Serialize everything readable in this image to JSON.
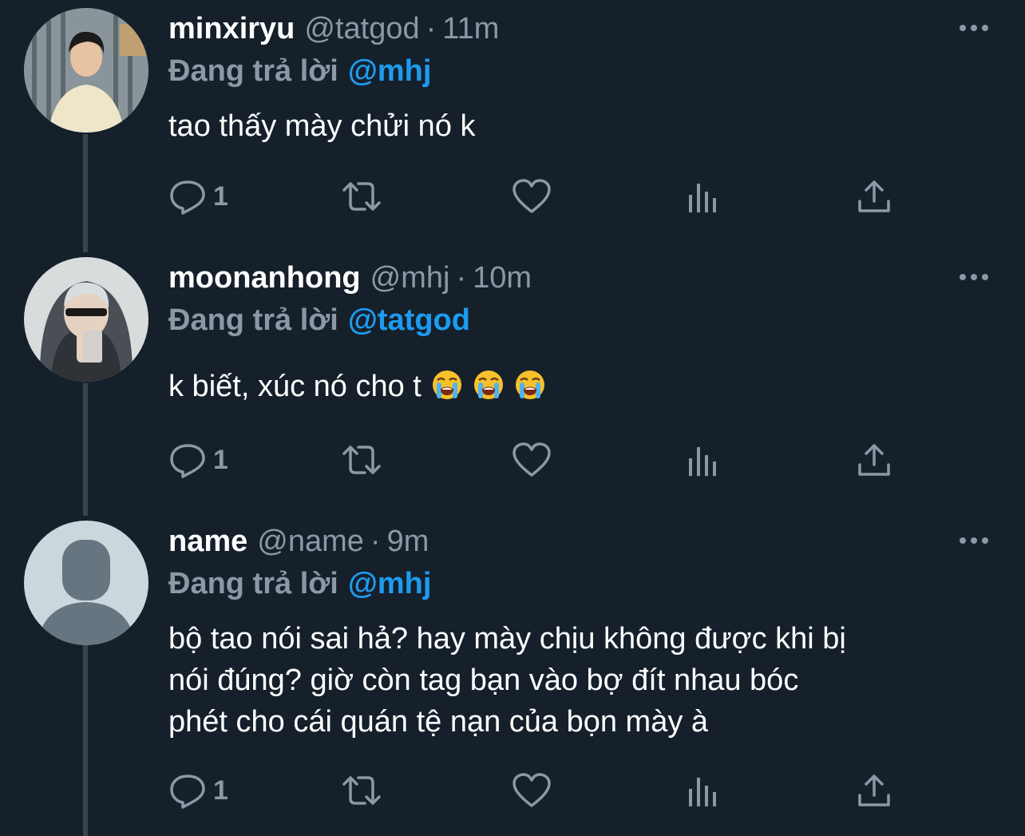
{
  "tweets": [
    {
      "display_name": "minxiryu",
      "handle": "@tatgod",
      "time": "11m",
      "reply_label": "Đang trả lời",
      "reply_to": "@mhj",
      "lines": [
        "tao thấy mày chửi nó k"
      ],
      "reply_count": "1"
    },
    {
      "display_name": "moonanhong",
      "handle": "@mhj",
      "time": "10m",
      "reply_label": "Đang trả lời",
      "reply_to": "@tatgod",
      "lines": [
        "k biết, xúc nó cho t"
      ],
      "emojis": [
        "loudly-crying-face",
        "loudly-crying-face",
        "loudly-crying-face"
      ],
      "reply_count": "1"
    },
    {
      "display_name": "name",
      "handle": "@name",
      "time": "9m",
      "reply_label": "Đang trả lời",
      "reply_to": "@mhj",
      "lines": [
        "bộ tao nói sai hả? hay mày chịu không được khi bị",
        "nói đúng? giờ còn tag bạn vào bợ đít nhau bóc",
        "phét cho cái quán tệ nạn của bọn mày à"
      ],
      "reply_count": "1"
    }
  ],
  "icons": {
    "reply": "reply-icon",
    "retweet": "retweet-icon",
    "like": "heart-icon",
    "views": "analytics-icon",
    "share": "share-icon",
    "more": "more-icon"
  },
  "colors": {
    "background": "#15202b",
    "secondary_text": "#8b98a5",
    "link": "#1d9bf0",
    "thread_line": "#38444d"
  }
}
